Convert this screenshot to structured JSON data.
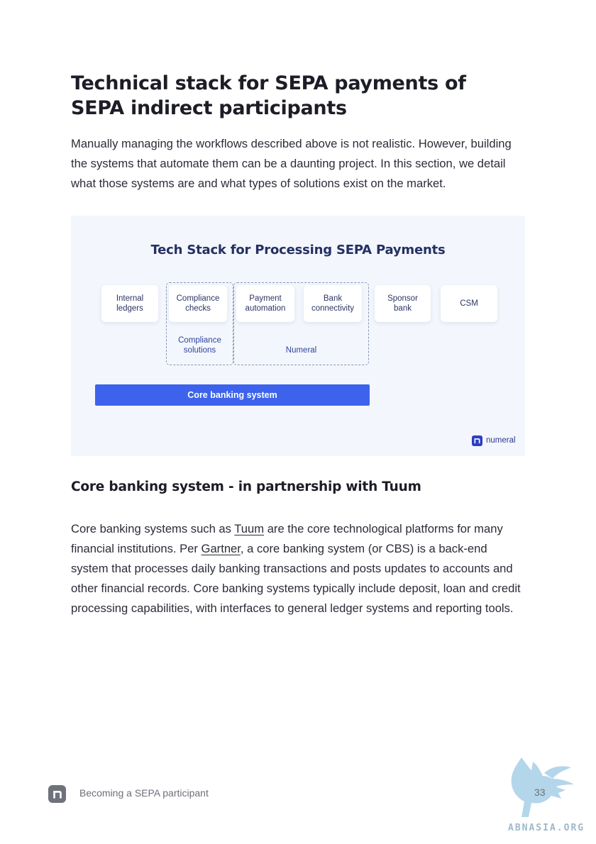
{
  "heading": "Technical stack for SEPA payments of SEPA indirect participants",
  "intro": "Manually managing the workflows described above is not realistic. However, building the systems that automate them can be a daunting project. In this section, we detail what those systems are and what types of solutions exist on the market.",
  "figure": {
    "title": "Tech Stack for Processing SEPA Payments",
    "boxes": [
      {
        "label": "Internal\nledgers"
      },
      {
        "label": "Compliance\nchecks"
      },
      {
        "label": "Payment\nautomation"
      },
      {
        "label": "Bank\nconnectivity"
      },
      {
        "label": "Sponsor\nbank"
      },
      {
        "label": "CSM"
      }
    ],
    "groups": [
      {
        "label": "Compliance\nsolutions"
      },
      {
        "label": "Numeral"
      }
    ],
    "core_banking_label": "Core banking system",
    "brand": "numeral",
    "colors": {
      "accent": "#3d63ec",
      "title": "#253063",
      "background": "#f3f6fc"
    }
  },
  "section_heading": "Core banking system - in partnership with Tuum",
  "paragraph": {
    "t1": "Core banking systems such as ",
    "link1": "Tuum",
    "t2": " are the core technological platforms for many financial institutions. Per ",
    "link2": "Gartner",
    "t3": ", a core banking system (or CBS) is a back-end system that processes daily banking transactions and posts updates to accounts and other financial records. Core banking systems typically include deposit, loan and credit processing capabilities, with interfaces to general ledger systems and reporting tools."
  },
  "footer": {
    "text": "Becoming a SEPA participant",
    "page_number": "33",
    "logo_icon": "numeral-logo-icon"
  },
  "watermark": "ABNASIA.ORG"
}
